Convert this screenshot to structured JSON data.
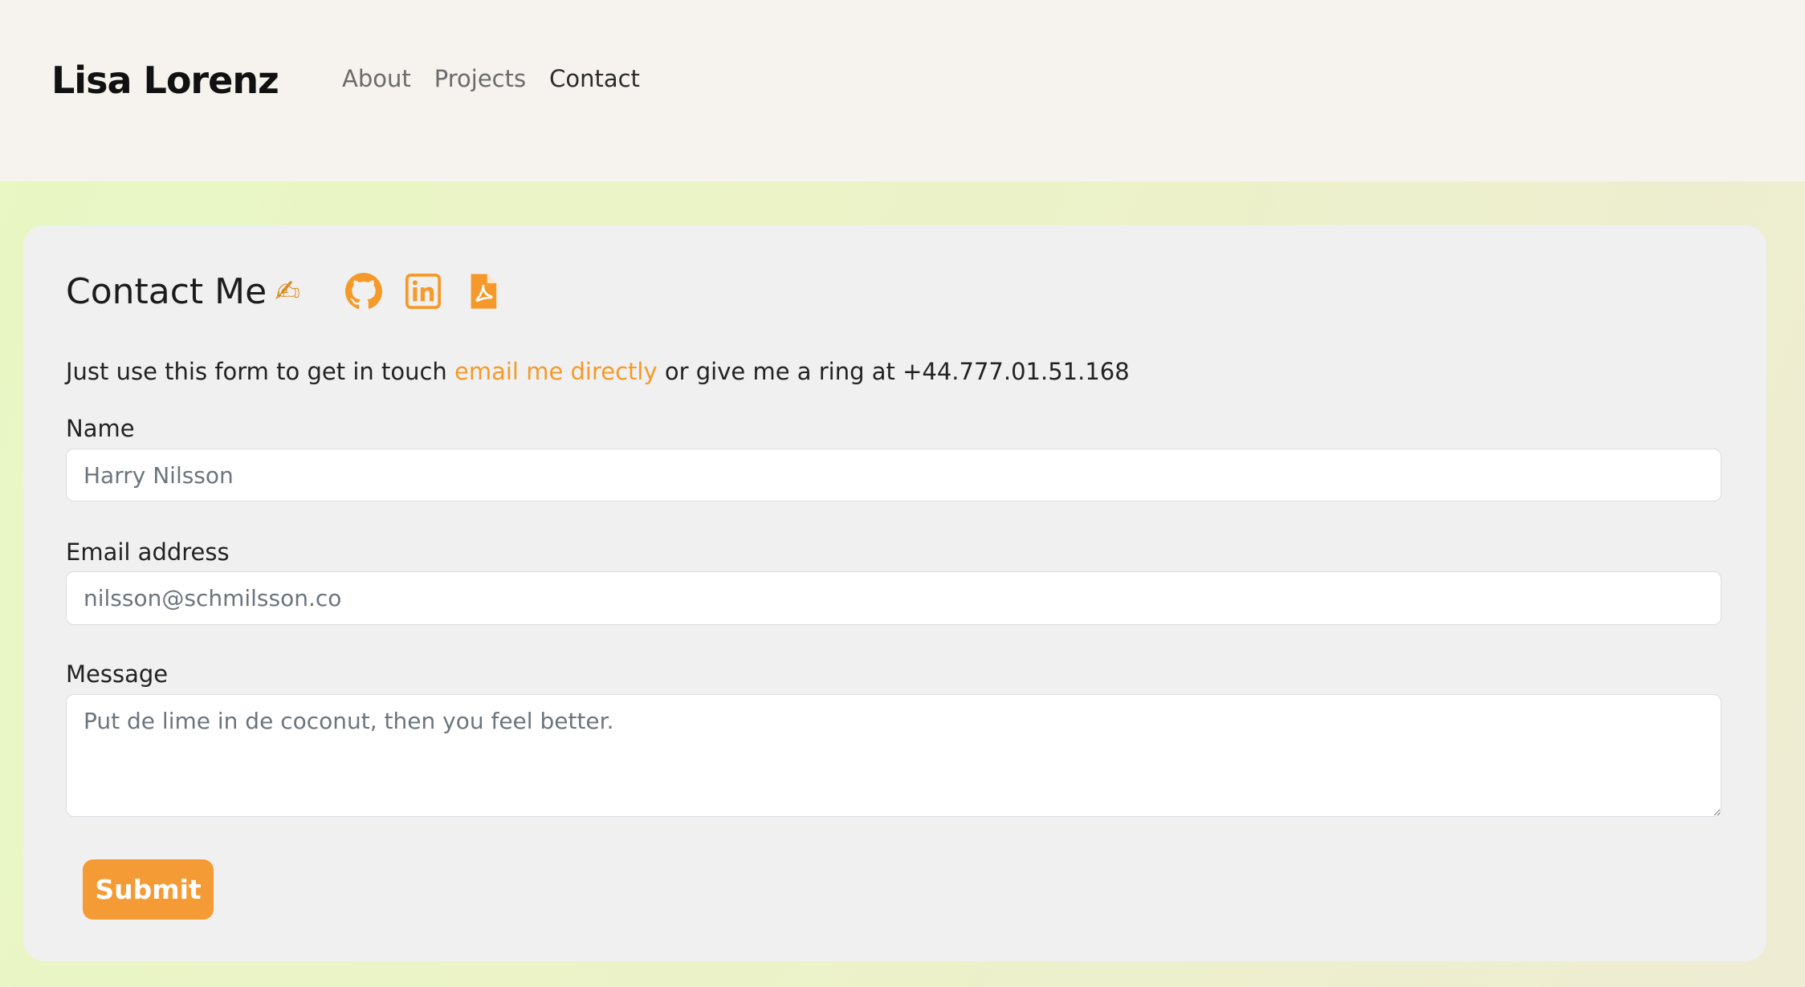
{
  "header": {
    "brand": "Lisa Lorenz",
    "nav": [
      {
        "label": "About",
        "active": false
      },
      {
        "label": "Projects",
        "active": false
      },
      {
        "label": "Contact",
        "active": true
      }
    ]
  },
  "contact": {
    "title": "Contact Me",
    "title_emoji": "✍",
    "social_icons": [
      "github-icon",
      "linkedin-icon",
      "pdf-icon"
    ],
    "intro_before": "Just use this form to get in touch ",
    "intro_link": "email me directly",
    "intro_after": " or give me a ring at +44.777.01.51.168",
    "form": {
      "name_label": "Name",
      "name_placeholder": "Harry Nilsson",
      "email_label": "Email address",
      "email_placeholder": "nilsson@schmilsson.co",
      "message_label": "Message",
      "message_placeholder": "Put de lime in de coconut, then you feel better.",
      "submit_label": "Submit"
    }
  },
  "colors": {
    "accent": "#f59a2a",
    "header_bg": "#f6f2ed",
    "card_bg": "#f0f0f0",
    "page_bg": "#e8f7c4"
  }
}
